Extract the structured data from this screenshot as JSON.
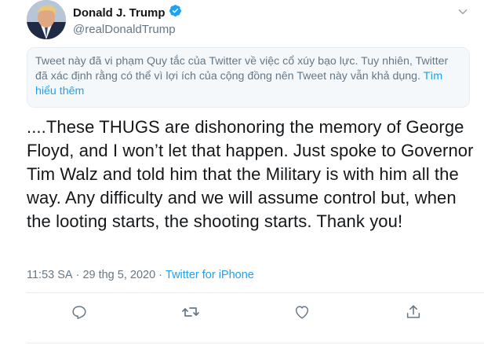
{
  "author": {
    "display_name": "Donald J. Trump",
    "handle": "@realDonaldTrump",
    "verified": true
  },
  "notice": {
    "text": "Tweet này đã vi phạm Quy tắc của Twitter về việc cổ xúy bạo lực. Tuy nhiên, Twitter đã xác định rằng có thể vì lợi ích của cộng đồng nên Tweet này vẫn khả dụng.",
    "link_label": "Tìm hiểu thêm"
  },
  "tweet": {
    "text": "....These THUGS are dishonoring the memory of George Floyd, and I won’t let that happen. Just spoke to Governor Tim Walz and told him that the Military is with him all the way. Any difficulty and we will assume control but, when the looting starts, the shooting starts. Thank you!"
  },
  "meta": {
    "time": "11:53 SA",
    "separator1": "·",
    "date": "29 thg 5, 2020",
    "separator2": "·",
    "source": "Twitter for iPhone"
  },
  "icons": {
    "verified": "verified-badge-icon",
    "more": "chevron-down-icon",
    "reply": "reply-icon",
    "retweet": "retweet-icon",
    "like": "heart-icon",
    "share": "share-icon"
  },
  "colors": {
    "accent": "#1da1f2",
    "secondary_text": "#657786",
    "primary_text": "#14171a",
    "notice_bg": "#f5f8fa"
  }
}
